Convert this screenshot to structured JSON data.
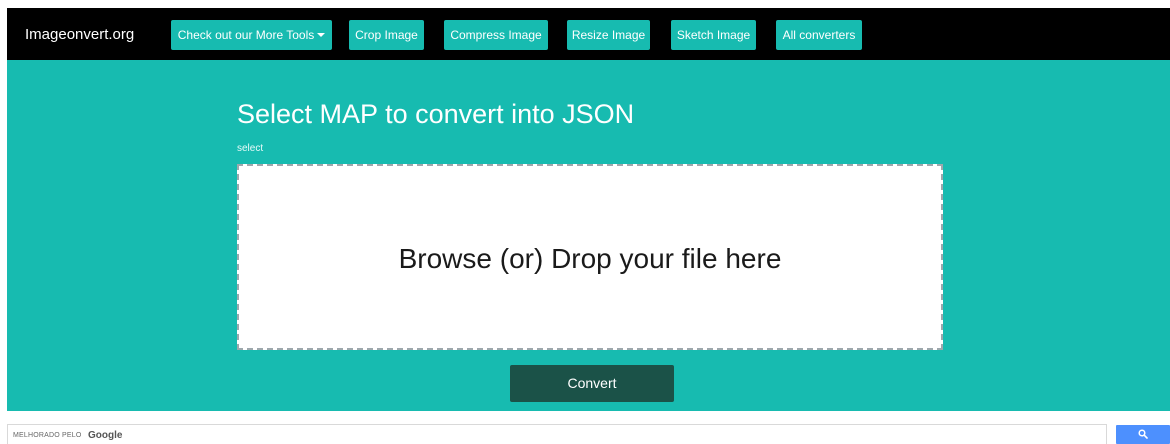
{
  "navbar": {
    "brand": "Imageonvert.org",
    "items": [
      {
        "label": "Check out our More Tools",
        "has_caret": true
      },
      {
        "label": "Crop Image"
      },
      {
        "label": "Compress Image"
      },
      {
        "label": "Resize Image"
      },
      {
        "label": "Sketch Image"
      },
      {
        "label": "All converters"
      }
    ]
  },
  "hero": {
    "title": "Select MAP to convert into JSON",
    "subtitle": "select",
    "dropzone_text": "Browse (or) Drop your file here",
    "convert_label": "Convert"
  },
  "search": {
    "brand_small": "MELHORADO PELO",
    "brand_google": "Google",
    "button_icon": "search-icon"
  },
  "colors": {
    "navbar_bg": "#000000",
    "accent": "#17bbb0",
    "convert_bg": "#1b5248",
    "search_button": "#4d90fe"
  }
}
